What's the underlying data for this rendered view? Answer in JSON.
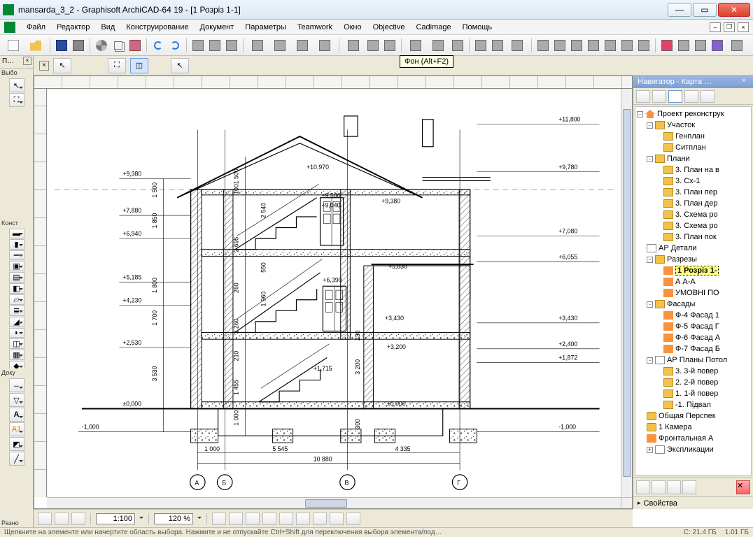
{
  "window": {
    "title": "mansarda_3_2 - Graphisoft ArchiCAD-64 19 - [1 Розріз 1-1]"
  },
  "menu": {
    "items": [
      "Файл",
      "Редактор",
      "Вид",
      "Конструирование",
      "Документ",
      "Параметры",
      "Teamwork",
      "Окно",
      "Objective",
      "Cadimage",
      "Помощь"
    ]
  },
  "tooltip": {
    "text": "Фон (Alt+F2)"
  },
  "leftbox": {
    "head": "П…",
    "sec_select": "Выбо",
    "sec_constr": "Конст",
    "sec_doc": "Доку",
    "sec_misc": "Разно"
  },
  "quick": {
    "scale": "1:100",
    "zoom": "120 %"
  },
  "navigator": {
    "title": "Навигатор - Карта …",
    "root": "Проект реконструк",
    "uchastok": "Участок",
    "genplan": "Генплан",
    "sitplan": "Ситплан",
    "plany": "Плани",
    "p3planv": "3. План на в",
    "p3cx1": "3. Сх-1",
    "p3per": "3. План пер",
    "p3der": "3. План дер",
    "p3sxema": "3. Схема ро",
    "p3sxema2": "3. Схема ро",
    "p3pok": "3. План пок",
    "apdet": "АР Детали",
    "razrezy": "Разрезы",
    "r1": "1 Розріз 1-",
    "raa": "А А-А",
    "umov": "УМОВНІ ПО",
    "fasady": "Фасады",
    "f4": "Ф-4 Фасад 1",
    "f5": "Ф-5 Фасад Г",
    "f6": "Ф-6 Фасад А",
    "f7": "Ф-7 Фасад Б",
    "appotol": "АР Планы Потол",
    "pot3": "3. 3-й повер",
    "pot2": "2. 2-й повер",
    "pot1": "1. 1-й повер",
    "potm1": "-1. Підвал",
    "persp": "Общая Перспек",
    "cam1": "1 Камера",
    "front": "Фронтальная А",
    "eksp": "Экспликации",
    "props": "Свойства"
  },
  "status": {
    "hint": "Щелкните на элементе или начертите область выбора. Нажмите и не отпускайте Ctrl+Shift для переключения выбора элемента/под…",
    "disk_c": "C: 21.4 ГБ",
    "disk_d": "1.01 ГБ"
  },
  "drawing": {
    "elev": {
      "l_9380": "+9,380",
      "l_7880": "+7,880",
      "l_6940": "+6,940",
      "l_5185": "+5,185",
      "l_4230": "+4,230",
      "l_2530": "+2,530",
      "l_0": "±0,000",
      "l_m1": "-1,000",
      "m_10970": "+10,970",
      "m_9580": "+9,580",
      "m_9040": "+9,040",
      "m_6390": "+6,390",
      "m_1715": "+1,715",
      "r_9380": "+9,380",
      "r_5830": "+5,830",
      "r_3430": "+3,430",
      "r_3200": "+3,200",
      "r_0": "±0,000",
      "fr_11800": "+11,800",
      "fr_9780": "+9,780",
      "fr_7080": "+7,080",
      "fr_6055": "+6,055",
      "fr_3430": "+3,430",
      "fr_2400": "+2,400",
      "fr_1872": "+1,872",
      "fr_m1": "-1,000"
    },
    "vdim": {
      "d1500": "1 500",
      "d1850": "1 850",
      "d1800": "1 800",
      "d1700": "1 700",
      "d3530": "3 530",
      "d1500b": "1 500",
      "d100": "100",
      "d2540": "2 540",
      "d2695": "2 695",
      "d260": "260",
      "d550": "550",
      "d1960": "1 960",
      "d3260": "3 260",
      "d210": "210",
      "d1455": "1 455",
      "d1000": "1 000",
      "d3200": "3 200",
      "d300": "300",
      "d230": "230"
    },
    "hdim": {
      "d1000": "1 000",
      "d5545": "5 545",
      "d4335": "4 335",
      "d10880": "10 880"
    },
    "axis": {
      "a": "А",
      "b": "Б",
      "v": "В",
      "g": "Г"
    }
  }
}
